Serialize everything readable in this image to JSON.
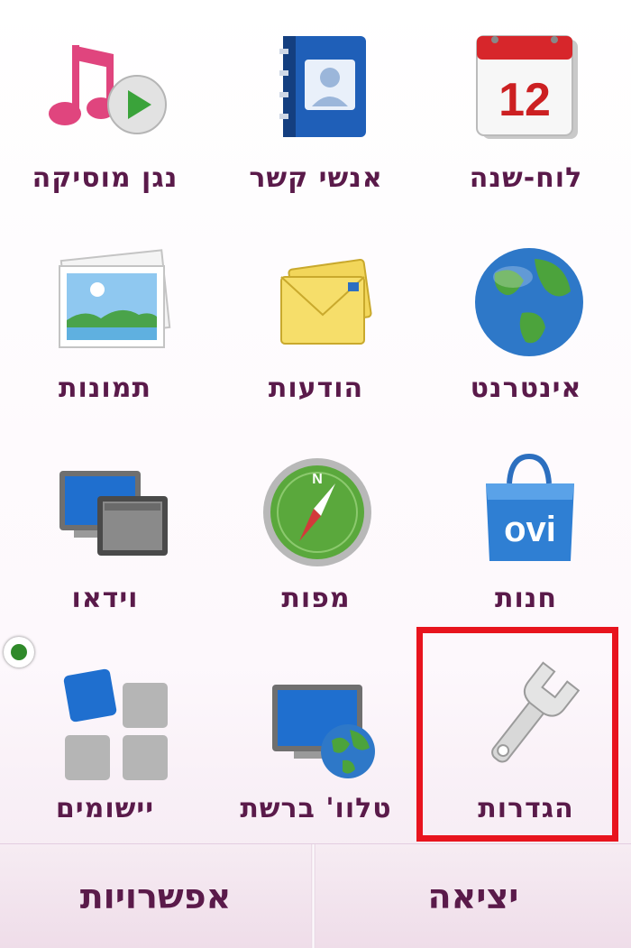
{
  "menu": {
    "items": [
      {
        "label": "לוח-שנה",
        "icon": "calendar-icon",
        "calendar_day": "12"
      },
      {
        "label": "אנשי קשר",
        "icon": "contacts-icon"
      },
      {
        "label": "נגן מוסיקה",
        "icon": "music-player-icon"
      },
      {
        "label": "אינטרנט",
        "icon": "internet-globe-icon"
      },
      {
        "label": "הודעות",
        "icon": "messages-envelope-icon"
      },
      {
        "label": "תמונות",
        "icon": "photos-icon"
      },
      {
        "label": "חנות",
        "icon": "ovi-store-bag-icon",
        "brand": "ovi"
      },
      {
        "label": "מפות",
        "icon": "compass-map-icon",
        "compass_letter": "N"
      },
      {
        "label": "וידאו",
        "icon": "video-monitors-icon"
      },
      {
        "label": "הגדרות",
        "icon": "wrench-settings-icon",
        "highlighted": true
      },
      {
        "label": "טלוו' ברשת",
        "icon": "web-tv-icon"
      },
      {
        "label": "יישומים",
        "icon": "applications-grid-icon"
      }
    ]
  },
  "softkeys": {
    "left": "אפשרויות",
    "right": "יציאה"
  },
  "colors": {
    "label": "#5a1a4a",
    "highlight_border": "#e8141e",
    "badge": "#2f8a2a"
  }
}
